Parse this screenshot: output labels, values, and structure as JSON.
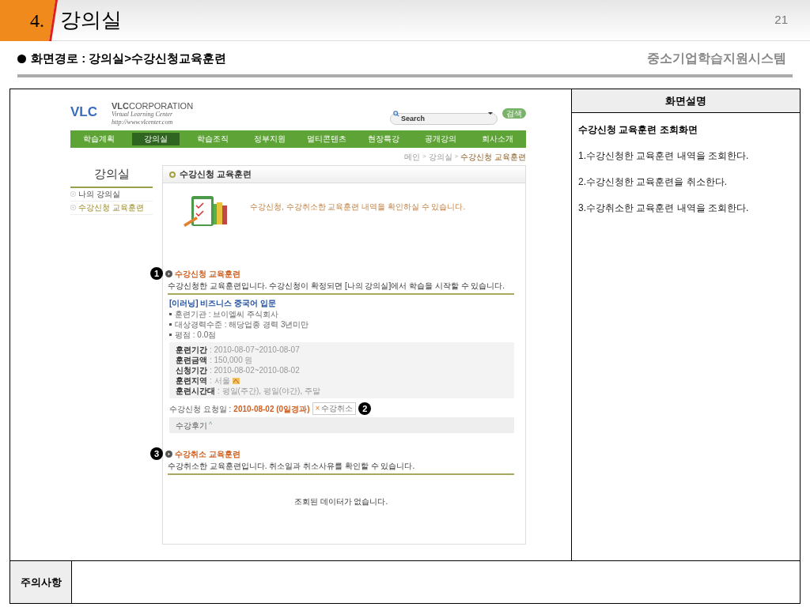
{
  "slide": {
    "number": "4.",
    "title": "강의실",
    "page": "21",
    "path_label": "화면경로 : 강의실>수강신청교육훈련",
    "system": "중소기업학습지원시스템"
  },
  "site": {
    "logo": {
      "mark": "VLC",
      "name_bold": "VLC",
      "name_rest": "CORPORATION",
      "tagline": "Virtual Learning Center",
      "url": "http://www.vlcenter.com"
    },
    "search": {
      "placeholder": "Search",
      "button": "검색"
    },
    "nav": [
      {
        "label": "학습계획",
        "selected": false
      },
      {
        "label": "강의실",
        "selected": true
      },
      {
        "label": "학습조직",
        "selected": false
      },
      {
        "label": "정부지원",
        "selected": false
      },
      {
        "label": "멀티콘텐츠",
        "selected": false
      },
      {
        "label": "현장특강",
        "selected": false
      },
      {
        "label": "공개강의",
        "selected": false
      },
      {
        "label": "회사소개",
        "selected": false
      }
    ],
    "breadcrumb": {
      "separator": ">",
      "items": [
        "메인",
        "강의실",
        "수강신청 교육훈련"
      ]
    },
    "sidebar": {
      "title": "강의실",
      "items": [
        {
          "label": "나의 강의실",
          "selected": false
        },
        {
          "label": "수강신청 교육훈련",
          "selected": true
        }
      ]
    },
    "content": {
      "heading": "수강신청 교육훈련",
      "intro": "수강신청, 수강취소한 교육훈련 내역을 확인하실 수 있습니다.",
      "section1": {
        "marker": "1",
        "title": "수강신청 교육훈련",
        "desc": "수강신청한 교육훈련입니다. 수강신청이 확정되면 [나의 강의실]에서 학습을 시작할 수 있습니다."
      },
      "course": {
        "title": "[이러닝] 비즈니스 중국어 입문",
        "bullets": [
          "훈련기관 : 브이엘씨 주식회사",
          "대상경력수준 : 해당업종 경력 3년미만",
          "평점 : 0.0점"
        ],
        "details": [
          {
            "label": "훈련기간",
            "value": ": 2010-08-07~2010-08-07"
          },
          {
            "label": "훈련금액",
            "value": ": 150,000 원"
          },
          {
            "label": "신청기간",
            "value": ": 2010-08-02~2010-08-02"
          },
          {
            "label": "훈련지역",
            "value": ":  서울"
          },
          {
            "label": "훈련시간대",
            "value": ":  평일(주간), 평일(야간), 주말"
          }
        ],
        "request_label": "수강신청 요청일 :",
        "request_value": "2010-08-02 (0일경과)",
        "cancel_mark": "×",
        "cancel_button": "수강취소",
        "marker": "2",
        "review": "수강후기",
        "review_caret": "^"
      },
      "section2": {
        "marker": "3",
        "title": "수강취소 교육훈련",
        "desc": "수강취소한 교육훈련입니다. 취소일과 취소사유를 확인할 수 있습니다.",
        "empty": "조회된 데이터가 없습니다."
      }
    }
  },
  "description": {
    "header": "화면설명",
    "title": "수강신청 교육훈련 조회화면",
    "items": [
      "1.수강신청한 교육훈련 내역을 조회한다.",
      "2.수강신청한 교육훈련을 취소한다.",
      "3.수강취소한 교육훈련 내역을 조회한다."
    ]
  },
  "notes": {
    "label": "주의사항"
  }
}
